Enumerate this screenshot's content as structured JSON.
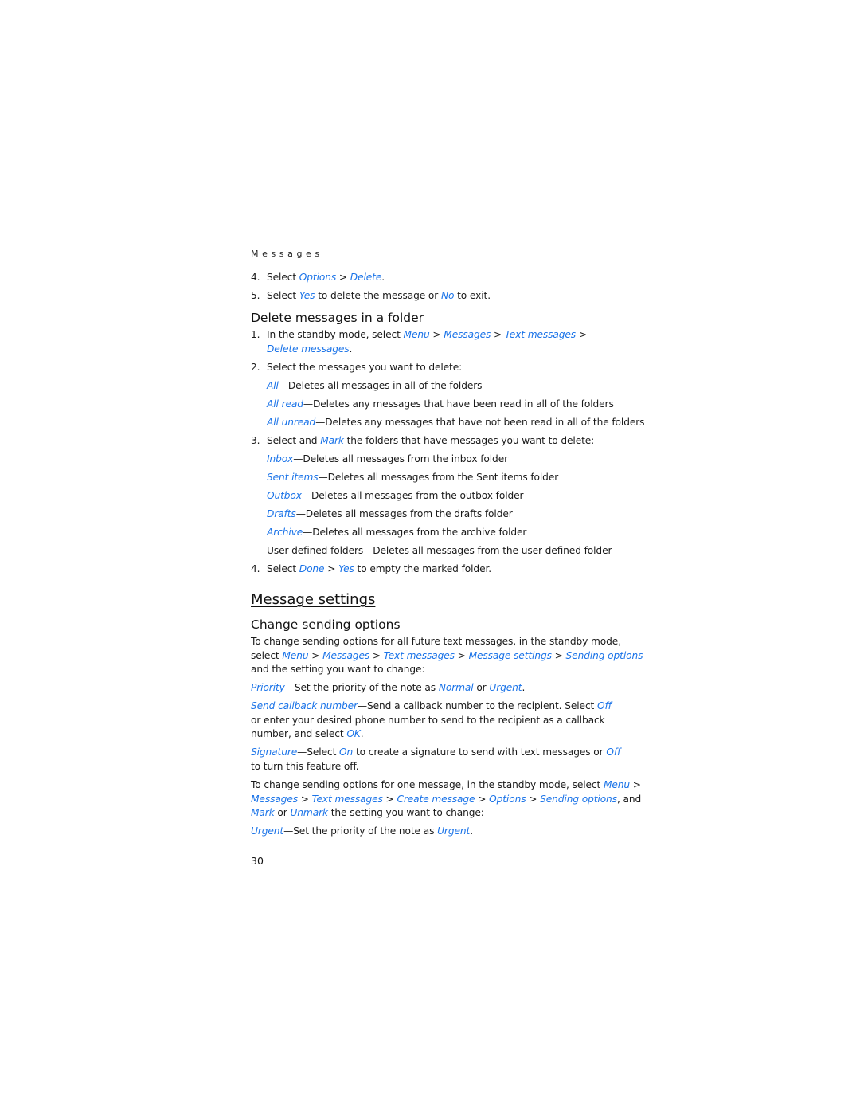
{
  "running_head": "Messages",
  "page_number": "30",
  "link_color": "#1a73e8",
  "intro_steps": [
    {
      "num": "4.",
      "parts": [
        "Select ",
        "Options",
        " > ",
        "Delete",
        "."
      ]
    },
    {
      "num": "5.",
      "parts": [
        "Select ",
        "Yes",
        " to delete the message or ",
        "No",
        " to exit."
      ]
    }
  ],
  "section_delete_folder": {
    "heading": "Delete messages in a folder",
    "step1": {
      "num": "1.",
      "line1": [
        "In the standby mode, select ",
        "Menu",
        " > ",
        "Messages",
        " > ",
        "Text messages",
        " >"
      ],
      "line2": [
        "Delete messages",
        "."
      ]
    },
    "step2": {
      "num": "2.",
      "text": "Select the messages you want to delete:",
      "options": [
        {
          "term": "All",
          "desc": "—Deletes all messages in all of the folders"
        },
        {
          "term": "All read",
          "desc": "—Deletes any messages that have been read in all of the folders"
        },
        {
          "term": "All unread",
          "desc": "—Deletes any messages that have not been read in all of the folders"
        }
      ]
    },
    "step3": {
      "num": "3.",
      "parts": [
        "Select and ",
        "Mark",
        " the folders that have messages you want to delete:"
      ],
      "options": [
        {
          "term": "Inbox",
          "desc": "—Deletes all messages from the inbox folder"
        },
        {
          "term": "Sent items",
          "desc": "—Deletes all messages from the Sent items folder"
        },
        {
          "term": "Outbox",
          "desc": "—Deletes all messages from the outbox folder"
        },
        {
          "term": "Drafts",
          "desc": "—Deletes all messages from the drafts folder"
        },
        {
          "term": "Archive",
          "desc": "—Deletes all messages from the archive folder"
        }
      ],
      "plain_option": "User defined folders—Deletes all messages from the user defined folder"
    },
    "step4": {
      "num": "4.",
      "parts": [
        "Select ",
        "Done",
        " > ",
        "Yes",
        " to empty the marked folder."
      ]
    }
  },
  "section_message_settings": {
    "heading": "Message settings",
    "subheading": "Change sending options",
    "intro_line1": "To change sending options for all future text messages, in the standby mode,",
    "intro_line2": [
      "select ",
      "Menu",
      " > ",
      "Messages",
      " > ",
      "Text messages",
      " > ",
      "Message settings",
      " > ",
      "Sending options"
    ],
    "intro_line3": "and the setting you want to change:",
    "priority": [
      "Priority",
      "—Set the priority of the note as ",
      "Normal",
      " or ",
      "Urgent",
      "."
    ],
    "callback_line1": [
      "Send callback number",
      "—Send a callback number to the recipient. Select ",
      "Off"
    ],
    "callback_line2": "or enter your desired phone number to send to the recipient as a callback",
    "callback_line3": [
      "number, and select ",
      "OK",
      "."
    ],
    "signature_line1": [
      "Signature",
      "—Select ",
      "On",
      " to create a signature to send with text messages or ",
      "Off"
    ],
    "signature_line2": "to turn this feature off.",
    "one_msg_line1": [
      "To change sending options for one message, in the standby mode, select ",
      "Menu",
      " >"
    ],
    "one_msg_line2": [
      "Messages",
      " > ",
      "Text messages",
      " > ",
      "Create message",
      " > ",
      "Options",
      " > ",
      "Sending options",
      ", and"
    ],
    "one_msg_line3": [
      "Mark",
      " or ",
      "Unmark",
      " the setting you want to change:"
    ],
    "urgent": [
      "Urgent",
      "—Set the priority of the note as ",
      "Urgent",
      "."
    ]
  }
}
